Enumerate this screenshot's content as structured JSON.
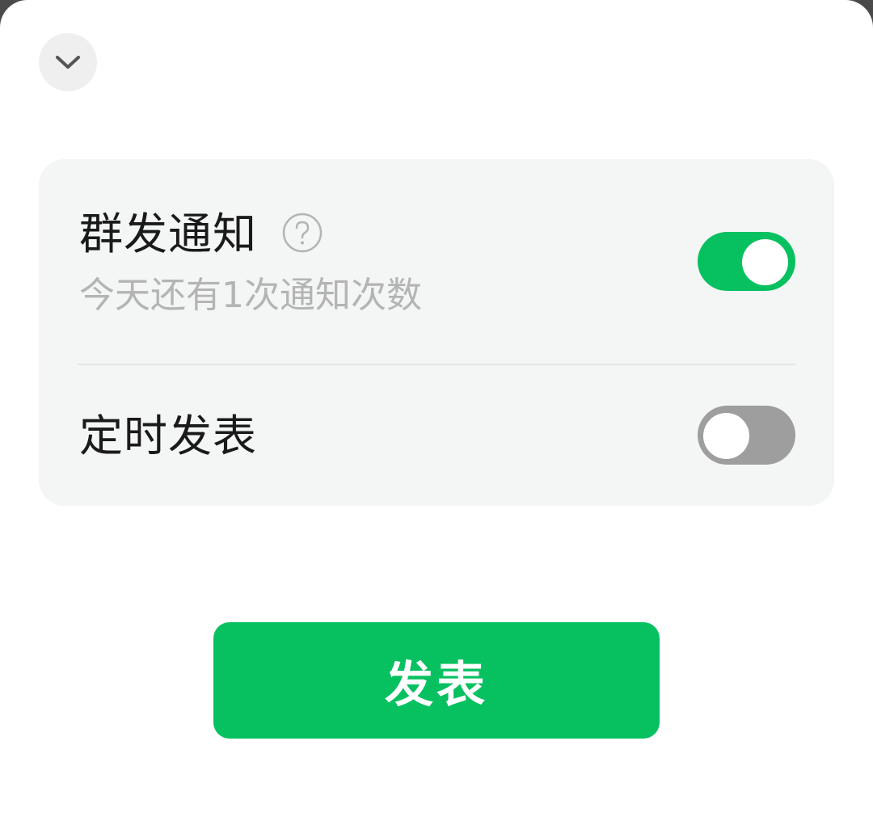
{
  "sheet": {
    "collapse_icon": "chevron-down-icon"
  },
  "settings": {
    "group_notify": {
      "title": "群发通知",
      "help_icon": "question-circle-icon",
      "subtitle": "今天还有1次通知次数",
      "enabled": true
    },
    "scheduled_publish": {
      "title": "定时发表",
      "enabled": false
    }
  },
  "actions": {
    "publish_label": "发表"
  },
  "colors": {
    "accent": "#07c160",
    "toggle_off": "#9e9e9e",
    "card_background": "#f4f5f5",
    "subtext": "#b4b4b4"
  }
}
